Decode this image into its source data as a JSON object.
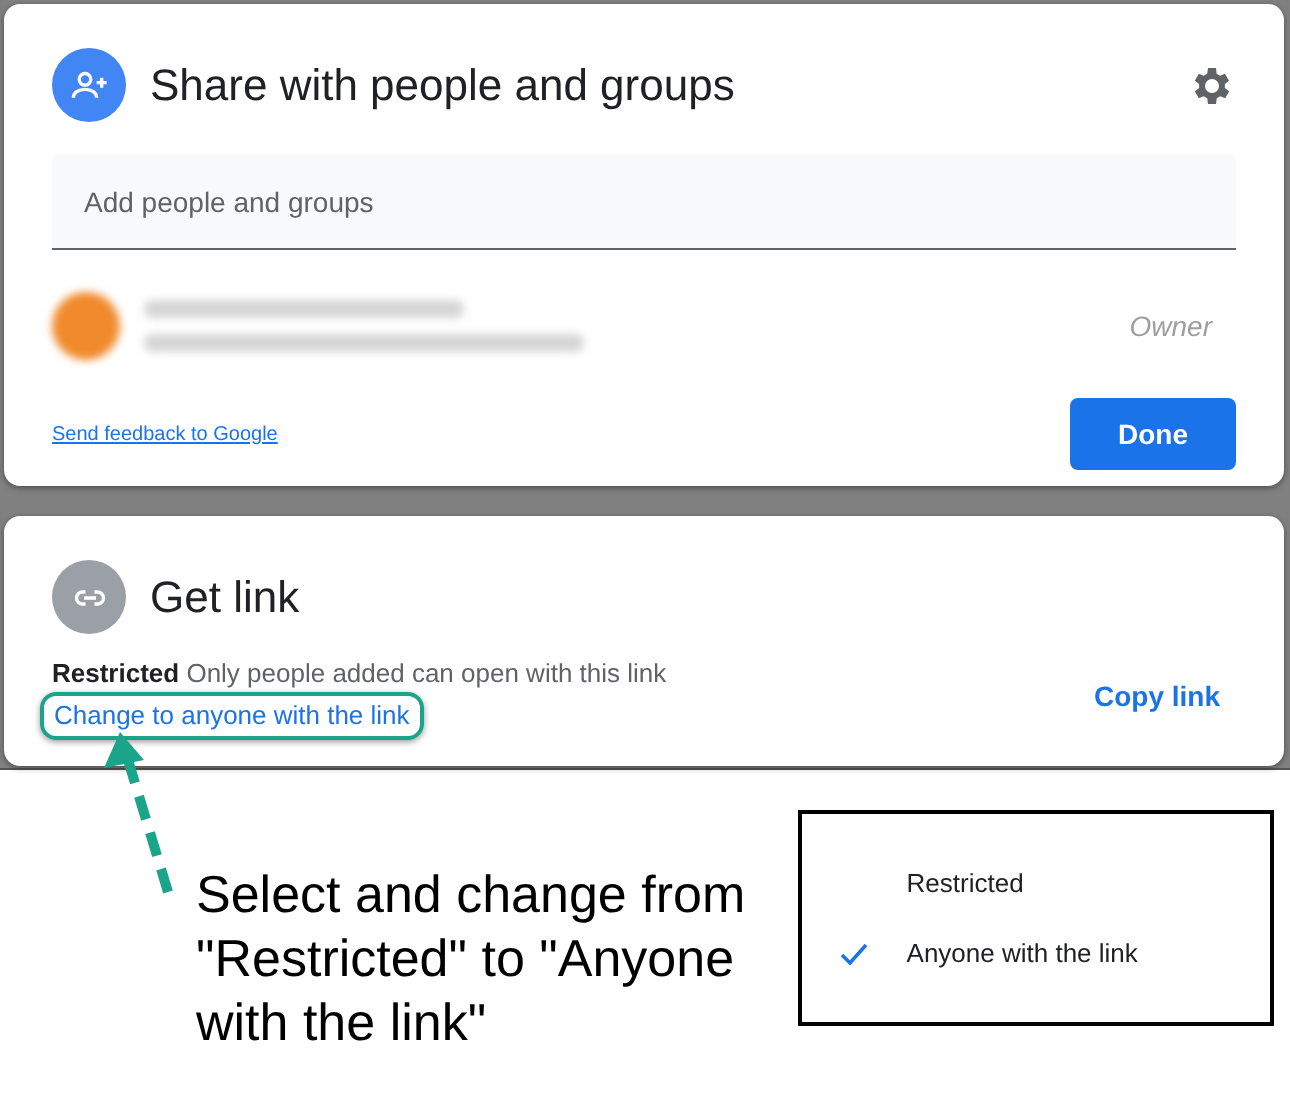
{
  "share_dialog": {
    "title": "Share with people and groups",
    "search": {
      "placeholder": "Add people and groups"
    },
    "people": [
      {
        "role": "Owner"
      }
    ],
    "feedback_link": "Send feedback to Google",
    "done_button": "Done"
  },
  "link_dialog": {
    "title": "Get link",
    "access": "Restricted",
    "access_description": "Only people added can open with this link",
    "change_link": "Change to anyone with the link",
    "copy_link": "Copy link"
  },
  "annotation": {
    "text": "Select and change from \"Restricted\" to \"Anyone with the link\""
  },
  "access_menu": {
    "options": [
      {
        "label": "Restricted",
        "selected": false
      },
      {
        "label": "Anyone with the link",
        "selected": true
      }
    ]
  }
}
